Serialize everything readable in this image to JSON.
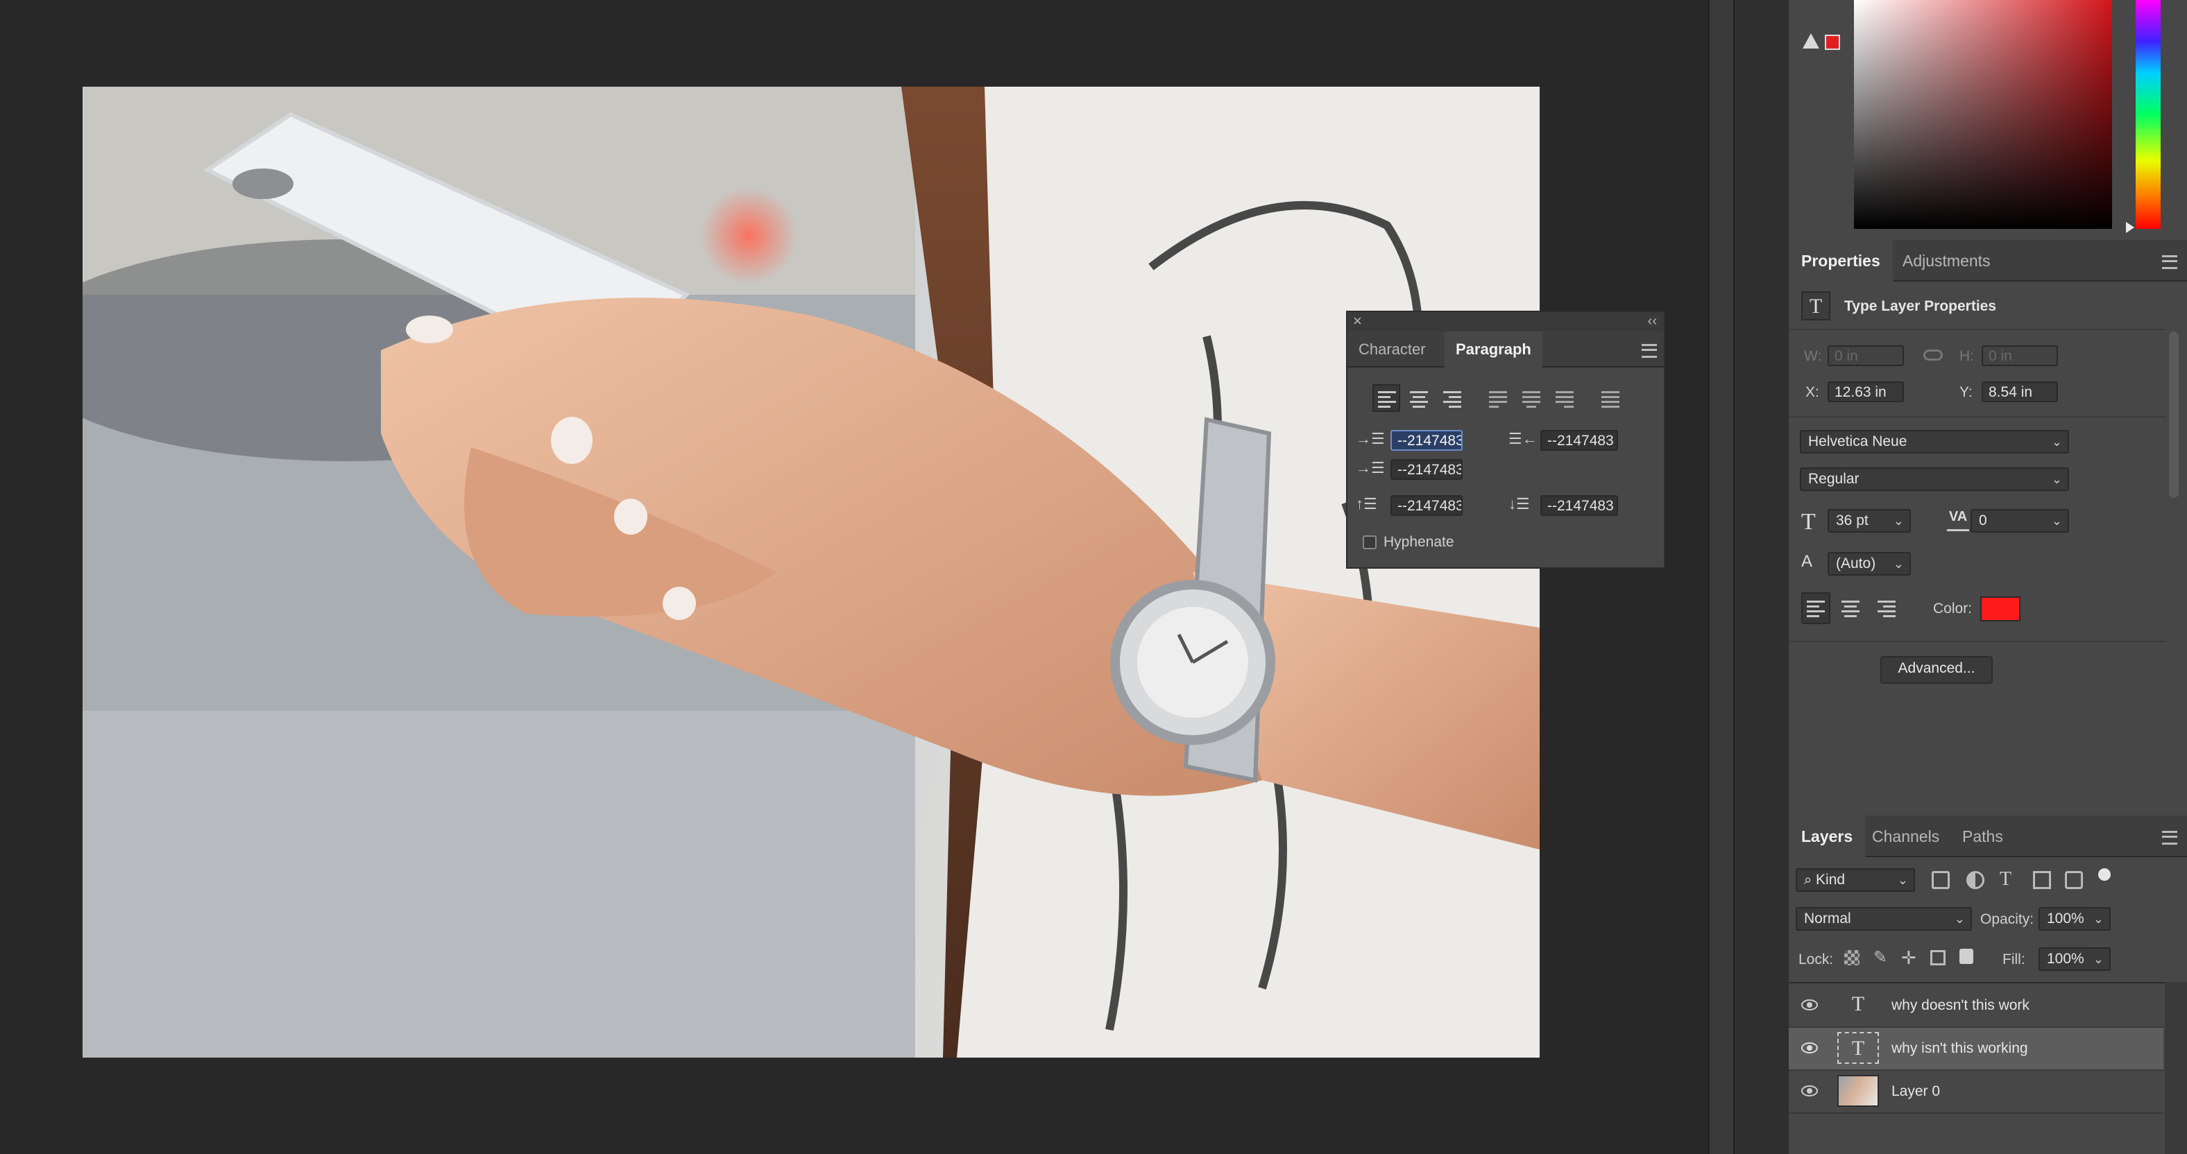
{
  "properties": {
    "tabs": [
      "Properties",
      "Adjustments"
    ],
    "section_title": "Type Layer Properties",
    "w_label": "W:",
    "w_value": "0 in",
    "h_label": "H:",
    "h_value": "0 in",
    "x_label": "X:",
    "x_value": "12.63 in",
    "y_label": "Y:",
    "y_value": "8.54 in",
    "font_family": "Helvetica Neue",
    "font_style": "Regular",
    "font_size": "36 pt",
    "tracking": "0",
    "leading": "(Auto)",
    "color_label": "Color:",
    "text_color": "#ff1a1a",
    "advanced_button": "Advanced..."
  },
  "paragraph_panel": {
    "tabs": [
      "Character",
      "Paragraph"
    ],
    "indent_left": "--2147483",
    "indent_right": "--2147483",
    "indent_first": "--2147483",
    "space_before": "--2147483",
    "space_after": "--2147483",
    "hyphenate_label": "Hyphenate"
  },
  "layers_panel": {
    "tabs": [
      "Layers",
      "Channels",
      "Paths"
    ],
    "filter_kind": "Kind",
    "blend_mode": "Normal",
    "opacity_label": "Opacity:",
    "opacity_value": "100%",
    "lock_label": "Lock:",
    "fill_label": "Fill:",
    "fill_value": "100%",
    "layers": [
      {
        "name": "why doesn't this work",
        "type": "text",
        "selected": false
      },
      {
        "name": "why isn't this working",
        "type": "text",
        "selected": true
      },
      {
        "name": "Layer 0",
        "type": "image",
        "selected": false
      }
    ]
  },
  "colors": {
    "foreground_swatch": "#e02020",
    "canvas_bg": "#282828",
    "panel_bg": "#474747"
  }
}
